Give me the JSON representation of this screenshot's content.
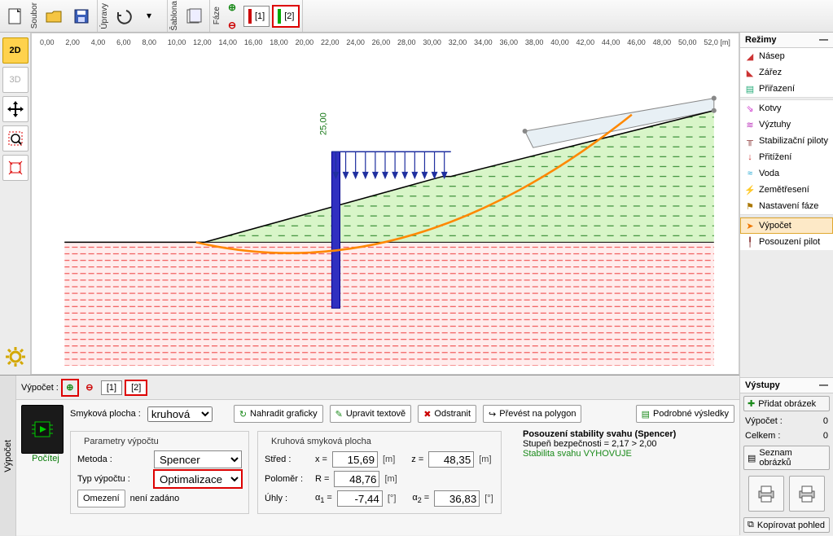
{
  "toolbar": {
    "file_label": "Soubor",
    "edit_label": "Úpravy",
    "template_label": "Šablona",
    "phase_label": "Fáze",
    "phase1": "[1]",
    "phase2": "[2]"
  },
  "view": {
    "btn2d": "2D",
    "btn3d": "3D"
  },
  "ruler": {
    "ticks": [
      "0,00",
      "2,00",
      "4,00",
      "6,00",
      "8,00",
      "10,00",
      "12,00",
      "14,00",
      "16,00",
      "18,00",
      "20,00",
      "22,00",
      "24,00",
      "26,00",
      "28,00",
      "30,00",
      "32,00",
      "34,00",
      "36,00",
      "38,00",
      "40,00",
      "42,00",
      "44,00",
      "46,00",
      "48,00",
      "50,00",
      "52,0"
    ],
    "unit": "[m]",
    "annotation": "25,00"
  },
  "modes": {
    "header": "Režimy",
    "items": [
      {
        "icon": "embankment-icon",
        "label": "Násep"
      },
      {
        "icon": "cut-icon",
        "label": "Zářez"
      },
      {
        "icon": "assign-icon",
        "label": "Přiřazení"
      },
      {
        "icon": "anchor-icon",
        "label": "Kotvy"
      },
      {
        "icon": "reinf-icon",
        "label": "Výztuhy"
      },
      {
        "icon": "pile-icon",
        "label": "Stabilizační piloty"
      },
      {
        "icon": "load-icon",
        "label": "Přitížení"
      },
      {
        "icon": "water-icon",
        "label": "Voda"
      },
      {
        "icon": "quake-icon",
        "label": "Zemětřesení"
      },
      {
        "icon": "phase-settings-icon",
        "label": "Nastavení fáze"
      },
      {
        "icon": "calc-icon",
        "label": "Výpočet"
      },
      {
        "icon": "pile-check-icon",
        "label": "Posouzení pilot"
      }
    ],
    "selected": 10
  },
  "outputs": {
    "header": "Výstupy",
    "add_image": "Přidat obrázek",
    "rows": [
      {
        "label": "Výpočet :",
        "value": "0"
      },
      {
        "label": "Celkem :",
        "value": "0"
      }
    ],
    "list_btn": "Seznam obrázků",
    "copy_btn": "Kopírovat pohled"
  },
  "bottom": {
    "side_label": "Výpočet",
    "tabrow": {
      "label": "Výpočet :",
      "add": "+",
      "remove": "−",
      "tab1": "[1]",
      "tab2": "[2]"
    },
    "calc_btn": "Počítej",
    "surface_label": "Smyková plocha :",
    "surface_value": "kruhová",
    "btn_replace": "Nahradit graficky",
    "btn_edit": "Upravit textově",
    "btn_delete": "Odstranit",
    "btn_polygon": "Převést na polygon",
    "btn_details": "Podrobné výsledky",
    "params_legend": "Parametry výpočtu",
    "method_label": "Metoda :",
    "method_value": "Spencer",
    "type_label": "Typ výpočtu :",
    "type_value": "Optimalizace",
    "limit_label": "Omezení",
    "limit_value": "není zadáno",
    "circle_legend": "Kruhová smyková plocha",
    "center_label": "Střed :",
    "x_sym": "x =",
    "x_val": "15,69",
    "x_unit": "[m]",
    "z_sym": "z =",
    "z_val": "48,35",
    "z_unit": "[m]",
    "radius_label": "Poloměr :",
    "r_sym": "R =",
    "r_val": "48,76",
    "r_unit": "[m]",
    "angles_label": "Úhly :",
    "a1_sym": "α1 =",
    "a1_val": "-7,44",
    "a1_unit": "[°]",
    "a2_sym": "α2 =",
    "a2_val": "36,83",
    "a2_unit": "[°]",
    "result": {
      "title": "Posouzení stability svahu (Spencer)",
      "line": "Stupeň bezpečnosti = 2,17 > 2,00",
      "ok": "Stabilita svahu VYHOVUJE"
    }
  }
}
